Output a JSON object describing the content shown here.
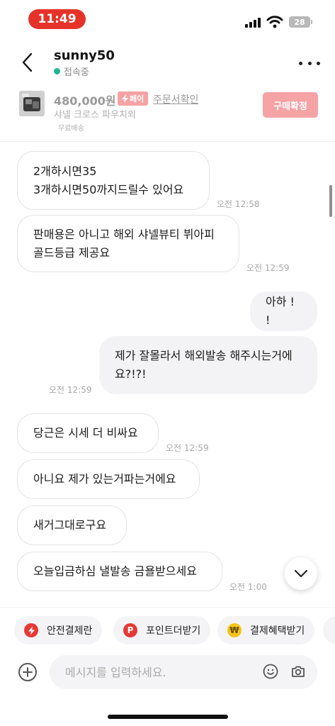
{
  "status_bar": {
    "time": "11:49",
    "battery": "28"
  },
  "header": {
    "seller_name": "sunny50",
    "online_status": "접속중"
  },
  "product": {
    "price": "480,000원",
    "pay_badge": "페이",
    "order_link": "주문서확인",
    "title": "샤넬 크로스 파우치외",
    "shipping": "무료배송",
    "confirm_button": "구매확정"
  },
  "messages": [
    {
      "side": "theirs",
      "lines": [
        "2개하시면35",
        "3개하시면50까지드릴수 있어요"
      ],
      "time": "오전 12:58"
    },
    {
      "side": "theirs",
      "lines": [
        "판매용은 아니고 해외 샤넬뷰티 뷔아피",
        "골드등급 제공요"
      ],
      "time": "오전 12:59"
    },
    {
      "side": "mine",
      "lines": [
        "아하 ! !"
      ],
      "time": ""
    },
    {
      "side": "mine",
      "lines": [
        "제가 잘몰라서 해외발송 해주시는거에",
        "요?!?!"
      ],
      "time": "오전 12:59"
    },
    {
      "side": "theirs",
      "lines": [
        "당근은 시세 더 비싸요"
      ],
      "time": "오전 12:59"
    },
    {
      "side": "theirs",
      "lines": [
        "아니요 제가 있는거파는거에요"
      ],
      "time": ""
    },
    {
      "side": "theirs",
      "lines": [
        "새거그대로구요"
      ],
      "time": ""
    },
    {
      "side": "theirs",
      "lines": [
        "오늘입금하심 낼발송 금욜받으세요"
      ],
      "time": "오전 1:00"
    }
  ],
  "quick_actions": [
    {
      "label": "안전결제란",
      "icon": "lightning-icon",
      "color": "#e53935"
    },
    {
      "label": "포인트더받기",
      "icon": "point-p-icon",
      "color": "#e53935"
    },
    {
      "label": "결제혜택받기",
      "icon": "won-coin-icon",
      "color": "#f5c518"
    }
  ],
  "input": {
    "placeholder": "메시지를 입력하세요."
  },
  "colors": {
    "accent": "#f5a3a5",
    "online": "#20b493",
    "status_pill": "#e5332a"
  }
}
